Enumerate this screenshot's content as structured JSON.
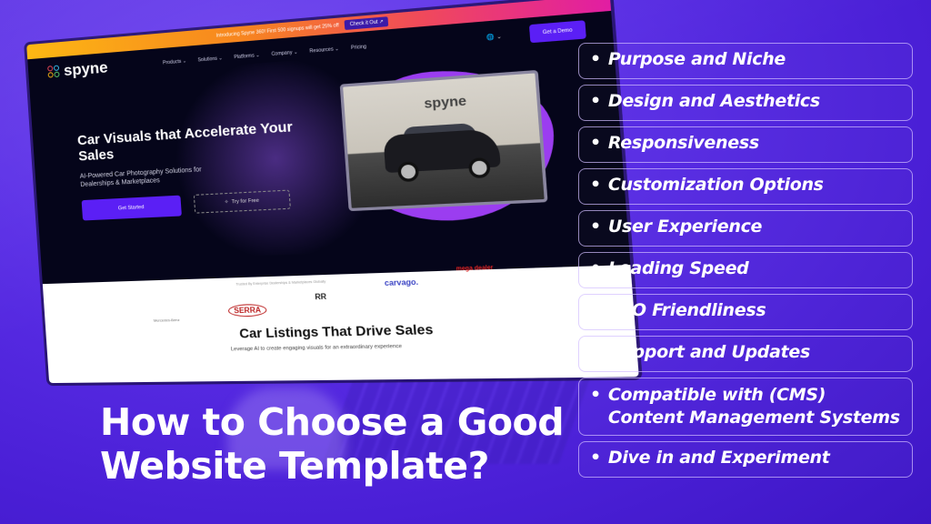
{
  "headline": {
    "line1": "How to Choose a Good",
    "line2": "Website Template?"
  },
  "checklist": [
    {
      "bullet": "•",
      "label": "Purpose and Niche"
    },
    {
      "bullet": "•",
      "label": "Design and Aesthetics"
    },
    {
      "bullet": "•",
      "label": "Responsiveness"
    },
    {
      "bullet": "•",
      "label": "Customization Options"
    },
    {
      "bullet": "•",
      "label": "User Experience"
    },
    {
      "bullet": "•",
      "label": "Loading Speed"
    },
    {
      "bullet": "•",
      "label": "SEO Friendliness"
    },
    {
      "bullet": "•",
      "label": "Support and Updates"
    },
    {
      "bullet": "•",
      "label": "Compatible with (CMS)",
      "label2": "Content Management Systems"
    },
    {
      "bullet": "•",
      "label": "Dive in and Experiment"
    }
  ],
  "website": {
    "promo_text": "Introducing Spyne 360! First 500 signups will get 25% off",
    "promo_button": "Check it Out ↗",
    "logo": "spyne",
    "nav": [
      "Products ⌄",
      "Solutions ⌄",
      "Platforms ⌄",
      "Company ⌄",
      "Resources ⌄",
      "Pricing"
    ],
    "language": "🌐 ⌄",
    "demo_button": "Get a Demo",
    "hero_title": "Car Visuals that Accelerate Your Sales",
    "hero_subtitle": "AI-Powered Car Photography Solutions for Dealerships & Marketplaces",
    "get_started": "Get Started",
    "try_free": "Try for Free",
    "try_icon": "✧",
    "car_card_logo": "spyne",
    "trusted_text": "Trusted By Enterprise Dealerships & Marketplaces Globally",
    "brands": [
      "SERRA",
      "Mercedes-Benz",
      "RR",
      "carvago.",
      "mega dealer"
    ],
    "section_title": "Car Listings That Drive Sales",
    "section_subtitle": "Leverage AI to create engaging visuals for an extraordinary experience"
  },
  "colors": {
    "background": "#5a2ee6",
    "accent": "#5b1ff5",
    "blob": "#9b3df0"
  }
}
